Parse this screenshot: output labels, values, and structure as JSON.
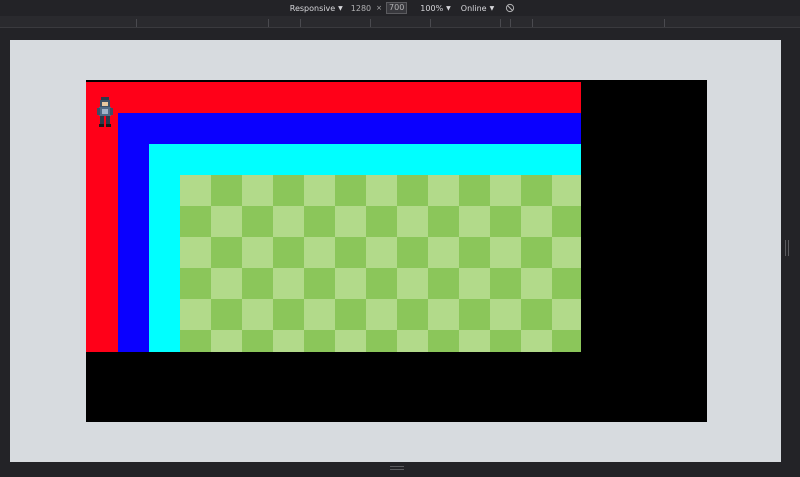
{
  "devtools": {
    "device_mode": "Responsive",
    "width": "1280",
    "times": "×",
    "height": "700",
    "zoom": "100%",
    "throttling": "Online",
    "caret_icon": "caret-down-icon",
    "rotate_icon": "rotate-icon"
  },
  "game": {
    "background": "#000000",
    "bands": [
      {
        "name": "red",
        "color": "#ff0018"
      },
      {
        "name": "blue",
        "color": "#0a00ff"
      },
      {
        "name": "cyan",
        "color": "#00ffff"
      }
    ],
    "checker_colors": [
      "#8bc65a",
      "#b2da8a"
    ],
    "sprite_icon": "character-sprite"
  }
}
